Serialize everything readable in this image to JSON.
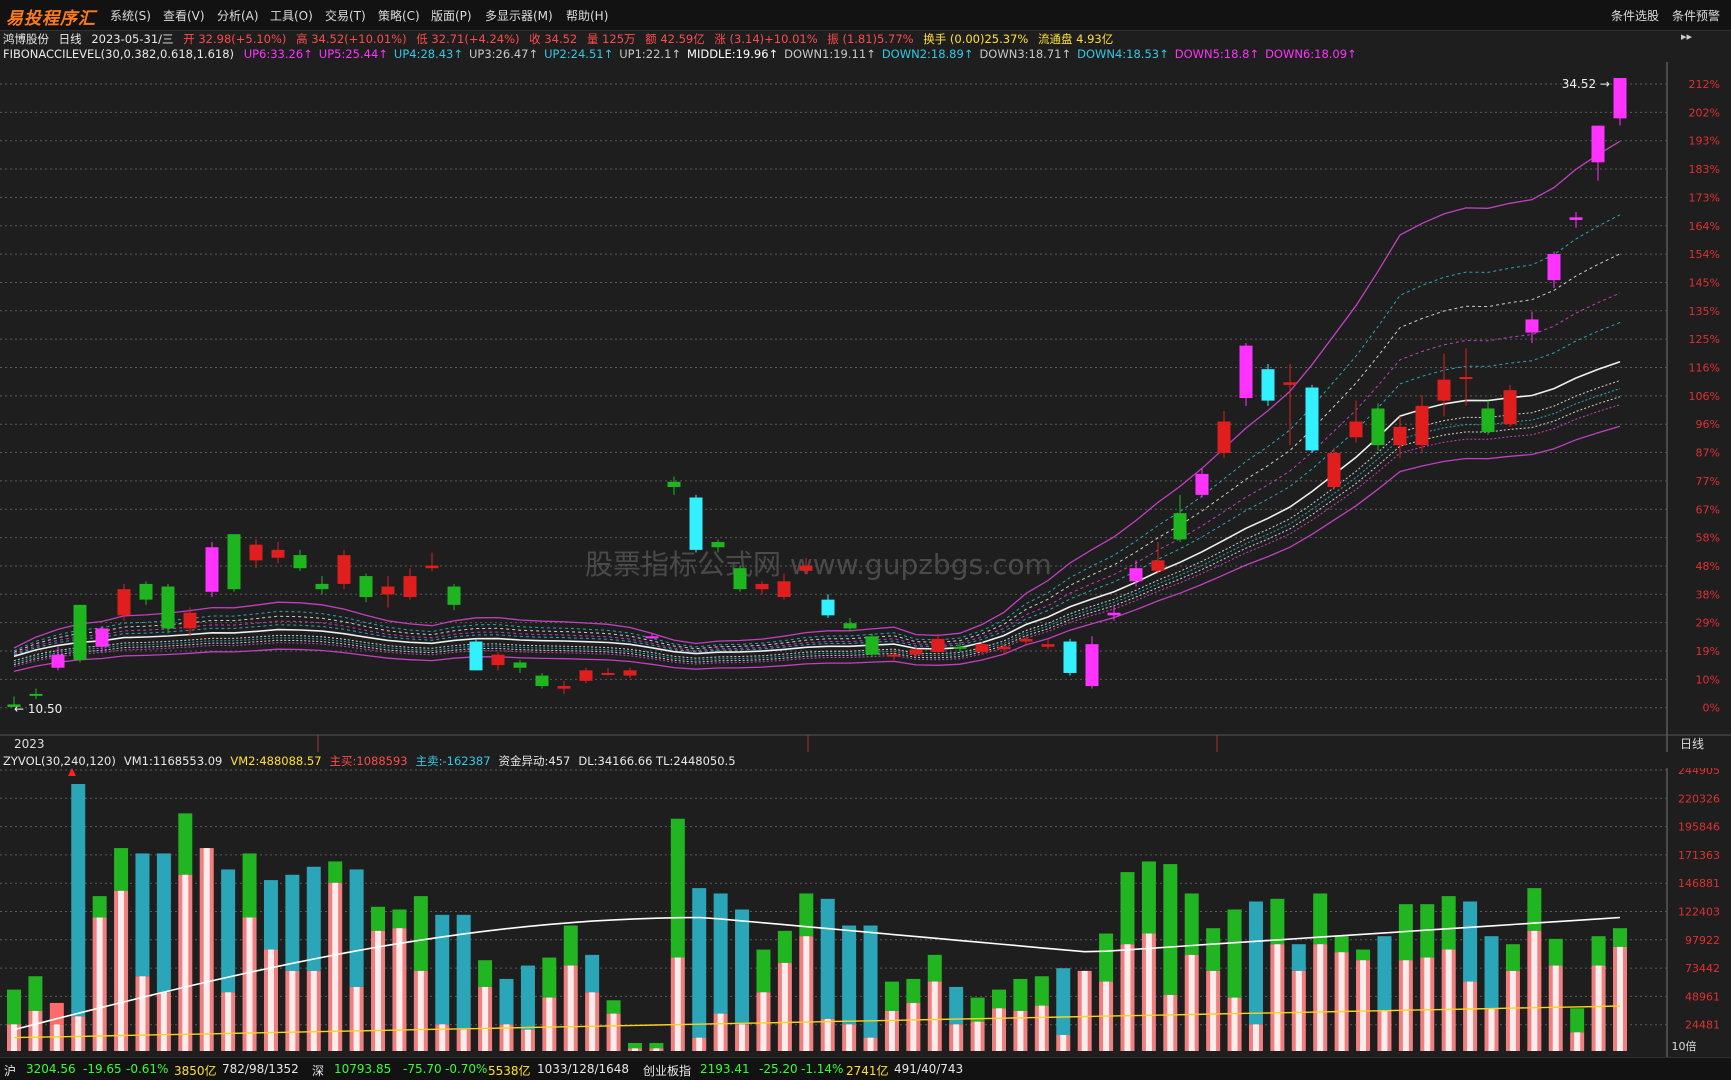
{
  "app": {
    "logo": "易投程序汇",
    "menu": [
      "系统(S)",
      "查看(V)",
      "分析(A)",
      "工具(O)",
      "交易(T)",
      "策略(C)",
      "版面(P)",
      "多显示器(M)",
      "帮助(H)"
    ],
    "menu_right": [
      "条件选股",
      "条件预警"
    ]
  },
  "header": {
    "stock_name": "鸿博股份",
    "period": "日线",
    "date": "2023-05-31/三",
    "open": "开 32.98(+5.10%)",
    "high": "高 34.52(+10.01%)",
    "low": "低 32.71(+4.24%)",
    "close": "收 34.52",
    "volume": "量 125万",
    "amount": "额 42.59亿",
    "change": "涨 (3.14)+10.01%",
    "amplitude": "振 (1.81)5.77%",
    "turnover": "换手 (0.00)25.37%",
    "float_shares": "流通盘 4.93亿"
  },
  "indicator": {
    "name": "FIBONACCILEVEL(30,0.382,0.618,1.618)",
    "levels": [
      {
        "label": "UP6:33.26",
        "color": "#ff33ff"
      },
      {
        "label": "UP5:25.44",
        "color": "#ff33ff"
      },
      {
        "label": "UP4:28.43",
        "color": "#33c9e6"
      },
      {
        "label": "UP3:26.47",
        "color": "#c8c8c8"
      },
      {
        "label": "UP2:24.51",
        "color": "#33c9e6"
      },
      {
        "label": "UP1:22.1",
        "color": "#c8c8c8"
      },
      {
        "label": "MIDDLE:19.96",
        "color": "#ffffff"
      },
      {
        "label": "DOWN1:19.11",
        "color": "#c8c8c8"
      },
      {
        "label": "DOWN2:18.89",
        "color": "#33c9e6"
      },
      {
        "label": "DOWN3:18.71",
        "color": "#c8c8c8"
      },
      {
        "label": "DOWN4:18.53",
        "color": "#33c9e6"
      },
      {
        "label": "DOWN5:18.8",
        "color": "#ff33ff"
      },
      {
        "label": "DOWN6:18.09",
        "color": "#ff33ff"
      }
    ]
  },
  "price_chart": {
    "y_axis_labels": [
      "212%",
      "202%",
      "193%",
      "183%",
      "173%",
      "164%",
      "154%",
      "145%",
      "135%",
      "125%",
      "116%",
      "106%",
      "96%",
      "87%",
      "77%",
      "67%",
      "58%",
      "48%",
      "38%",
      "29%",
      "19%",
      "10%",
      "0%"
    ],
    "max_label": "34.52",
    "min_label": "10.50",
    "x_label": "2023",
    "period_tag": "日线",
    "watermark": "股票指标公式网 www.gupzbgs.com",
    "candles": [
      {
        "o": 10.5,
        "c": 10.6,
        "h": 10.9,
        "l": 10.5,
        "t": "bull"
      },
      {
        "o": 11.0,
        "c": 11.0,
        "h": 11.2,
        "l": 10.8,
        "t": "bull"
      },
      {
        "o": 12.0,
        "c": 12.5,
        "h": 12.8,
        "l": 11.9,
        "t": "mag"
      },
      {
        "o": 14.4,
        "c": 12.3,
        "h": 14.4,
        "l": 12.2,
        "t": "bear"
      },
      {
        "o": 12.8,
        "c": 13.5,
        "h": 13.6,
        "l": 12.6,
        "t": "mag"
      },
      {
        "o": 14.0,
        "c": 15.0,
        "h": 15.2,
        "l": 13.8,
        "t": "red"
      },
      {
        "o": 15.2,
        "c": 14.6,
        "h": 15.3,
        "l": 14.4,
        "t": "bear"
      },
      {
        "o": 15.1,
        "c": 13.5,
        "h": 15.2,
        "l": 13.3,
        "t": "bear"
      },
      {
        "o": 13.5,
        "c": 14.1,
        "h": 14.3,
        "l": 13.2,
        "t": "red"
      },
      {
        "o": 14.9,
        "c": 16.6,
        "h": 16.8,
        "l": 14.7,
        "t": "mag"
      },
      {
        "o": 17.1,
        "c": 15.0,
        "h": 17.1,
        "l": 14.9,
        "t": "bear"
      },
      {
        "o": 16.1,
        "c": 16.7,
        "h": 16.9,
        "l": 15.8,
        "t": "red"
      },
      {
        "o": 16.5,
        "c": 16.2,
        "h": 16.8,
        "l": 16.0,
        "t": "red"
      },
      {
        "o": 16.3,
        "c": 15.8,
        "h": 16.5,
        "l": 15.7,
        "t": "bear"
      },
      {
        "o": 15.2,
        "c": 15.0,
        "h": 15.5,
        "l": 14.8,
        "t": "bear"
      },
      {
        "o": 15.2,
        "c": 16.3,
        "h": 16.5,
        "l": 15.0,
        "t": "red"
      },
      {
        "o": 15.5,
        "c": 14.7,
        "h": 15.6,
        "l": 14.5,
        "t": "bear"
      },
      {
        "o": 14.8,
        "c": 15.1,
        "h": 15.5,
        "l": 14.3,
        "t": "red"
      },
      {
        "o": 14.7,
        "c": 15.5,
        "h": 15.8,
        "l": 14.6,
        "t": "red"
      },
      {
        "o": 15.8,
        "c": 15.9,
        "h": 16.4,
        "l": 15.7,
        "t": "red"
      },
      {
        "o": 15.1,
        "c": 14.4,
        "h": 15.2,
        "l": 14.2,
        "t": "bear"
      },
      {
        "o": 13.0,
        "c": 11.9,
        "h": 13.1,
        "l": 11.9,
        "t": "cyan"
      },
      {
        "o": 12.1,
        "c": 12.5,
        "h": 12.6,
        "l": 11.9,
        "t": "red"
      },
      {
        "o": 12.0,
        "c": 12.2,
        "h": 12.3,
        "l": 11.8,
        "t": "bear"
      },
      {
        "o": 11.7,
        "c": 11.3,
        "h": 11.8,
        "l": 11.2,
        "t": "bear"
      },
      {
        "o": 11.2,
        "c": 11.3,
        "h": 11.5,
        "l": 11.0,
        "t": "red"
      },
      {
        "o": 11.5,
        "c": 11.9,
        "h": 12.0,
        "l": 11.4,
        "t": "red"
      },
      {
        "o": 11.8,
        "c": 11.8,
        "h": 12.0,
        "l": 11.7,
        "t": "red"
      },
      {
        "o": 11.7,
        "c": 11.9,
        "h": 12.0,
        "l": 11.6,
        "t": "red"
      },
      {
        "o": 13.2,
        "c": 13.2,
        "h": 13.3,
        "l": 13.1,
        "t": "mag"
      },
      {
        "o": 18.9,
        "c": 19.1,
        "h": 19.3,
        "l": 18.6,
        "t": "bear"
      },
      {
        "o": 18.5,
        "c": 16.5,
        "h": 18.6,
        "l": 16.4,
        "t": "cyan"
      },
      {
        "o": 16.6,
        "c": 16.8,
        "h": 16.9,
        "l": 16.4,
        "t": "bear"
      },
      {
        "o": 15.8,
        "c": 15.0,
        "h": 15.9,
        "l": 14.9,
        "t": "bear"
      },
      {
        "o": 15.0,
        "c": 15.2,
        "h": 15.3,
        "l": 14.8,
        "t": "red"
      },
      {
        "o": 15.3,
        "c": 14.7,
        "h": 15.6,
        "l": 14.6,
        "t": "red"
      },
      {
        "o": 15.9,
        "c": 15.7,
        "h": 16.2,
        "l": 15.6,
        "t": "red"
      },
      {
        "o": 14.6,
        "c": 14.0,
        "h": 14.8,
        "l": 13.9,
        "t": "cyan"
      },
      {
        "o": 13.7,
        "c": 13.5,
        "h": 13.9,
        "l": 13.4,
        "t": "bear"
      },
      {
        "o": 13.2,
        "c": 12.5,
        "h": 13.3,
        "l": 12.4,
        "t": "bear"
      },
      {
        "o": 12.5,
        "c": 12.5,
        "h": 12.7,
        "l": 12.3,
        "t": "red"
      },
      {
        "o": 12.5,
        "c": 12.7,
        "h": 12.8,
        "l": 12.4,
        "t": "red"
      },
      {
        "o": 12.6,
        "c": 13.1,
        "h": 13.3,
        "l": 12.5,
        "t": "red"
      },
      {
        "o": 12.8,
        "c": 12.8,
        "h": 13.0,
        "l": 12.6,
        "t": "bear"
      },
      {
        "o": 12.6,
        "c": 12.9,
        "h": 13.0,
        "l": 12.5,
        "t": "red"
      },
      {
        "o": 12.7,
        "c": 12.8,
        "h": 12.9,
        "l": 12.5,
        "t": "red"
      },
      {
        "o": 13.0,
        "c": 13.1,
        "h": 13.2,
        "l": 12.9,
        "t": "red"
      },
      {
        "o": 12.9,
        "c": 12.8,
        "h": 13.1,
        "l": 12.7,
        "t": "red"
      },
      {
        "o": 13.0,
        "c": 11.8,
        "h": 13.1,
        "l": 11.7,
        "t": "cyan"
      },
      {
        "o": 11.3,
        "c": 12.9,
        "h": 13.2,
        "l": 11.2,
        "t": "mag"
      },
      {
        "o": 14.0,
        "c": 14.1,
        "h": 14.4,
        "l": 13.8,
        "t": "mag"
      },
      {
        "o": 15.8,
        "c": 15.3,
        "h": 16.1,
        "l": 15.1,
        "t": "mag"
      },
      {
        "o": 15.7,
        "c": 16.1,
        "h": 16.8,
        "l": 15.6,
        "t": "red"
      },
      {
        "o": 16.9,
        "c": 17.9,
        "h": 18.6,
        "l": 16.8,
        "t": "bear"
      },
      {
        "o": 18.6,
        "c": 19.4,
        "h": 19.6,
        "l": 18.5,
        "t": "mag"
      },
      {
        "o": 20.2,
        "c": 21.4,
        "h": 21.8,
        "l": 20.0,
        "t": "red"
      },
      {
        "o": 22.3,
        "c": 24.3,
        "h": 24.4,
        "l": 22.0,
        "t": "mag"
      },
      {
        "o": 23.4,
        "c": 22.2,
        "h": 23.6,
        "l": 22.0,
        "t": "cyan"
      },
      {
        "o": 22.8,
        "c": 22.9,
        "h": 23.6,
        "l": 20.5,
        "t": "red"
      },
      {
        "o": 22.7,
        "c": 20.3,
        "h": 22.8,
        "l": 20.2,
        "t": "cyan"
      },
      {
        "o": 20.2,
        "c": 18.9,
        "h": 20.4,
        "l": 18.8,
        "t": "red"
      },
      {
        "o": 21.4,
        "c": 20.8,
        "h": 22.2,
        "l": 20.6,
        "t": "red"
      },
      {
        "o": 20.5,
        "c": 21.9,
        "h": 22.1,
        "l": 20.3,
        "t": "bear"
      },
      {
        "o": 20.5,
        "c": 21.2,
        "h": 21.6,
        "l": 20.0,
        "t": "red"
      },
      {
        "o": 20.5,
        "c": 22.0,
        "h": 22.4,
        "l": 20.2,
        "t": "red"
      },
      {
        "o": 22.2,
        "c": 23.0,
        "h": 24.0,
        "l": 21.6,
        "t": "red"
      },
      {
        "o": 23.1,
        "c": 23.1,
        "h": 24.2,
        "l": 22.0,
        "t": "red"
      },
      {
        "o": 21.0,
        "c": 21.9,
        "h": 22.2,
        "l": 20.9,
        "t": "bear"
      },
      {
        "o": 21.3,
        "c": 22.6,
        "h": 22.8,
        "l": 21.2,
        "t": "red"
      },
      {
        "o": 24.8,
        "c": 25.3,
        "h": 25.6,
        "l": 24.4,
        "t": "mag"
      },
      {
        "o": 26.8,
        "c": 27.8,
        "h": 27.9,
        "l": 26.5,
        "t": "mag"
      },
      {
        "o": 29.2,
        "c": 29.1,
        "h": 29.4,
        "l": 28.8,
        "t": "mag"
      },
      {
        "o": 31.3,
        "c": 32.7,
        "h": 32.7,
        "l": 30.6,
        "t": "mag"
      },
      {
        "o": 32.98,
        "c": 34.52,
        "h": 34.52,
        "l": 32.71,
        "t": "mag"
      }
    ]
  },
  "volume": {
    "indicator_name": "ZYVOL(30,240,120)",
    "vm1": "VM1:1168553.09",
    "vm2": "VM2:488088.57",
    "main_buy": "主买:1088593",
    "main_sell": "主卖:-162387",
    "fund_abnormal": "资金异动:457",
    "dl_tl": "DL:34166.66 TL:2448050.5",
    "y_axis_labels": [
      "244905",
      "220326",
      "195846",
      "171363",
      "146881",
      "122403",
      "97922",
      "73442",
      "48961",
      "24481"
    ],
    "unit_label": "10倍",
    "bars": [
      [
        0.23,
        0.1,
        "g"
      ],
      [
        0.28,
        0.15,
        "g"
      ],
      [
        0.18,
        0.1,
        "r"
      ],
      [
        1.0,
        0.13,
        "c"
      ],
      [
        0.58,
        0.5,
        "g"
      ],
      [
        0.76,
        0.6,
        "g"
      ],
      [
        0.74,
        0.28,
        "c"
      ],
      [
        0.74,
        0.22,
        "c"
      ],
      [
        0.89,
        0.66,
        "g"
      ],
      [
        0.76,
        0.76,
        "r"
      ],
      [
        0.68,
        0.22,
        "c"
      ],
      [
        0.74,
        0.5,
        "g"
      ],
      [
        0.64,
        0.38,
        "c"
      ],
      [
        0.66,
        0.3,
        "c"
      ],
      [
        0.69,
        0.3,
        "c"
      ],
      [
        0.71,
        0.63,
        "g"
      ],
      [
        0.68,
        0.24,
        "c"
      ],
      [
        0.54,
        0.45,
        "g"
      ],
      [
        0.53,
        0.46,
        "g"
      ],
      [
        0.58,
        0.3,
        "g"
      ],
      [
        0.51,
        0.1,
        "c"
      ],
      [
        0.51,
        0.08,
        "c"
      ],
      [
        0.34,
        0.24,
        "g"
      ],
      [
        0.27,
        0.1,
        "c"
      ],
      [
        0.32,
        0.08,
        "c"
      ],
      [
        0.35,
        0.2,
        "g"
      ],
      [
        0.47,
        0.32,
        "g"
      ],
      [
        0.36,
        0.22,
        "c"
      ],
      [
        0.19,
        0.14,
        "g"
      ],
      [
        0.03,
        0.01,
        "g"
      ],
      [
        0.03,
        0.01,
        "g"
      ],
      [
        0.87,
        0.35,
        "g"
      ],
      [
        0.61,
        0.05,
        "c"
      ],
      [
        0.59,
        0.14,
        "c"
      ],
      [
        0.53,
        0.1,
        "c"
      ],
      [
        0.38,
        0.22,
        "g"
      ],
      [
        0.45,
        0.33,
        "g"
      ],
      [
        0.59,
        0.43,
        "g"
      ],
      [
        0.57,
        0.12,
        "c"
      ],
      [
        0.47,
        0.1,
        "c"
      ],
      [
        0.47,
        0.05,
        "c"
      ],
      [
        0.26,
        0.15,
        "g"
      ],
      [
        0.27,
        0.18,
        "g"
      ],
      [
        0.36,
        0.26,
        "g"
      ],
      [
        0.24,
        0.1,
        "c"
      ],
      [
        0.2,
        0.11,
        "g"
      ],
      [
        0.23,
        0.16,
        "g"
      ],
      [
        0.27,
        0.15,
        "g"
      ],
      [
        0.28,
        0.17,
        "g"
      ],
      [
        0.31,
        0.06,
        "c"
      ],
      [
        0.3,
        0.3,
        "r"
      ],
      [
        0.44,
        0.26,
        "g"
      ],
      [
        0.67,
        0.4,
        "g"
      ],
      [
        0.71,
        0.44,
        "g"
      ],
      [
        0.7,
        0.21,
        "g"
      ],
      [
        0.59,
        0.36,
        "g"
      ],
      [
        0.46,
        0.3,
        "g"
      ],
      [
        0.53,
        0.2,
        "g"
      ],
      [
        0.56,
        0.1,
        "c"
      ],
      [
        0.57,
        0.4,
        "g"
      ],
      [
        0.4,
        0.3,
        "c"
      ],
      [
        0.59,
        0.4,
        "g"
      ],
      [
        0.43,
        0.37,
        "g"
      ],
      [
        0.38,
        0.34,
        "g"
      ],
      [
        0.43,
        0.15,
        "c"
      ],
      [
        0.55,
        0.34,
        "g"
      ],
      [
        0.55,
        0.35,
        "g"
      ],
      [
        0.58,
        0.38,
        "g"
      ],
      [
        0.56,
        0.26,
        "c"
      ],
      [
        0.43,
        0.16,
        "c"
      ],
      [
        0.4,
        0.3,
        "g"
      ],
      [
        0.61,
        0.45,
        "g"
      ],
      [
        0.42,
        0.32,
        "g"
      ],
      [
        0.16,
        0.07,
        "g"
      ],
      [
        0.43,
        0.32,
        "g"
      ],
      [
        0.46,
        0.39,
        "g"
      ]
    ]
  },
  "status_bar": {
    "sh_label": "沪",
    "sh_index": "3204.56",
    "sh_change": "-19.65",
    "sh_pct": "-0.61%",
    "sh_amount": "3850亿",
    "sh_breadth": "782/98/1352",
    "sz_label": "深",
    "sz_index": "10793.85",
    "sz_change": "-75.70",
    "sz_pct": "-0.70%",
    "sz_amount": "5538亿",
    "sz_breadth": "1033/128/1648",
    "cy_label": "创业板指",
    "cy_index": "2193.41",
    "cy_change": "-25.20",
    "cy_pct": "-1.14%",
    "cy_amount": "2741亿",
    "cy_breadth": "491/40/743"
  },
  "colors": {
    "up": "#ff3d3d",
    "down": "#1fb51f",
    "cyan": "#33f0ff",
    "magenta": "#ff33ff",
    "bg": "#1e1e1e",
    "grid": "#5a5a5a"
  }
}
